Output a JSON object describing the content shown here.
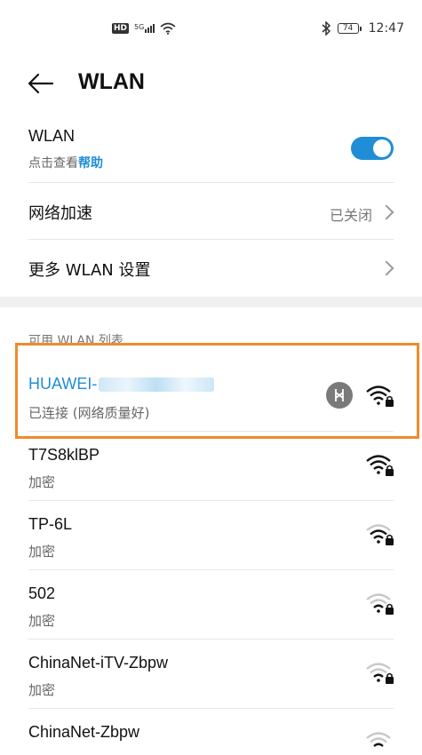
{
  "status_bar": {
    "hd_badge": "HD",
    "network": "5G",
    "battery": "74",
    "time": "12:47"
  },
  "header": {
    "title": "WLAN"
  },
  "settings": {
    "wlan_label": "WLAN",
    "wlan_help_prefix": "点击查看",
    "wlan_help_link": "帮助",
    "wlan_enabled": true,
    "network_accel_label": "网络加速",
    "network_accel_value": "已关闭",
    "more_settings_label": "更多 WLAN 设置"
  },
  "wlan_list": {
    "section_title": "可用 WLAN 列表",
    "connected": {
      "name_prefix": "HUAWEI-",
      "status": "已连接 (网络质量好)"
    },
    "networks": [
      {
        "name": "T7S8klBP",
        "status": "加密"
      },
      {
        "name": "TP-6L",
        "status": "加密"
      },
      {
        "name": "502",
        "status": "加密"
      },
      {
        "name": "ChinaNet-iTV-Zbpw",
        "status": "加密"
      },
      {
        "name": "ChinaNet-Zbpw",
        "status": ""
      }
    ]
  },
  "colors": {
    "accent": "#1f8ed6",
    "highlight_border": "#f08b2c"
  }
}
